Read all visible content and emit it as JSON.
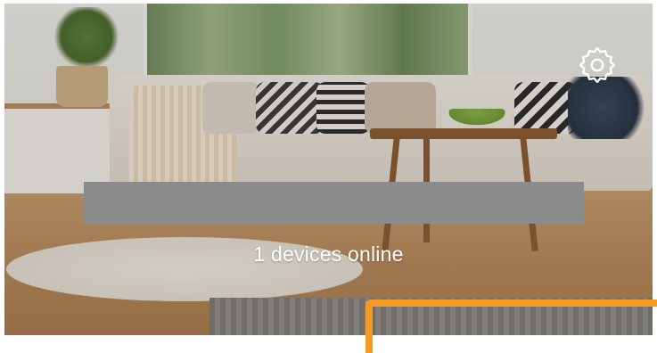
{
  "home": {
    "name": "",
    "devices_online_text": "1 devices online"
  },
  "icons": {
    "settings": "gear-icon"
  },
  "colors": {
    "accent": "#f59a23",
    "name_bar": "#8b8b8b",
    "status_text": "#ffffff"
  }
}
